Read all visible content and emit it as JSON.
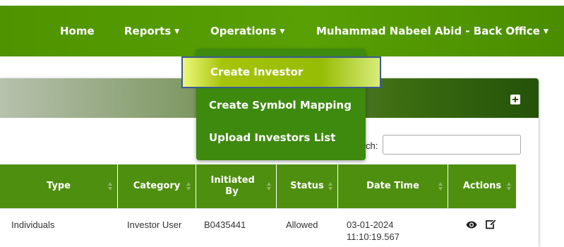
{
  "nav": {
    "home": "Home",
    "reports": "Reports",
    "operations": "Operations",
    "user": "Muhammad Nabeel Abid - Back Office"
  },
  "dropdown": {
    "items": [
      {
        "label": "Create Investor"
      },
      {
        "label": "Create Symbol Mapping"
      },
      {
        "label": "Upload Investors List"
      }
    ]
  },
  "search": {
    "label": "ch:",
    "value": ""
  },
  "table": {
    "headers": [
      "Type",
      "Category",
      "Initiated By",
      "Status",
      "Date Time",
      "Actions"
    ],
    "rows": [
      {
        "type": "Individuals",
        "category": "Investor User",
        "initiated_by": "B0435441",
        "status": "Allowed",
        "date_time": "03-01-2024 11:10:19.567"
      }
    ]
  },
  "icons": {
    "plus": "plus-square-icon",
    "view": "eye-icon",
    "edit": "edit-icon"
  },
  "colors": {
    "navbar": "#58a004",
    "dropdown": "#3e8a0f",
    "highlight": "#a7c40c",
    "table_header": "#4f8f0f"
  }
}
